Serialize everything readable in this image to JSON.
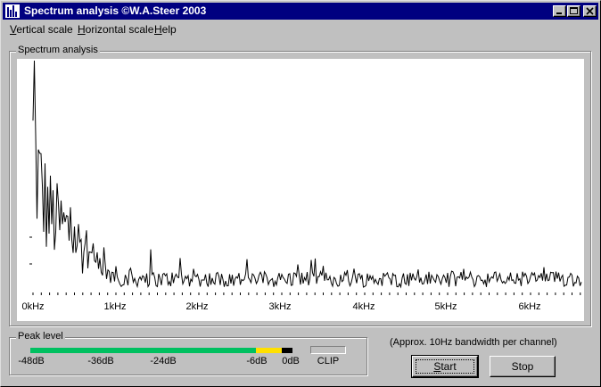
{
  "window": {
    "title": "Spectrum analysis  ©W.A.Steer 2003",
    "controls": [
      "minimize",
      "maximize",
      "close"
    ]
  },
  "menu": {
    "items": [
      {
        "label": "Vertical scale",
        "accel": "V",
        "rest": "ertical scale"
      },
      {
        "label": "Horizontal scale",
        "accel": "H",
        "rest": "orizontal scale"
      },
      {
        "label": "Help",
        "accel": "H",
        "rest": "elp"
      }
    ]
  },
  "spectrum": {
    "group_label": "Spectrum analysis",
    "x_ticks": [
      "0kHz",
      "1kHz",
      "2kHz",
      "3kHz",
      "4kHz",
      "5kHz",
      "6kHz"
    ],
    "x_max_khz": 6.6,
    "bandwidth_note": "(Approx. 10Hz bandwidth per channel)"
  },
  "peak": {
    "group_label": "Peak level",
    "scale_labels": [
      "-48dB",
      "-36dB",
      "-24dB",
      "-6dB",
      "0dB"
    ],
    "clip_label": "CLIP",
    "green_fraction": 0.86,
    "yellow_fraction": 0.1
  },
  "buttons": {
    "start": {
      "accel": "S",
      "rest": "tart"
    },
    "stop": {
      "label": "Stop"
    }
  },
  "colors": {
    "titlebar": "#000080",
    "meter_green": "#00c060",
    "meter_yellow": "#ffe000"
  }
}
